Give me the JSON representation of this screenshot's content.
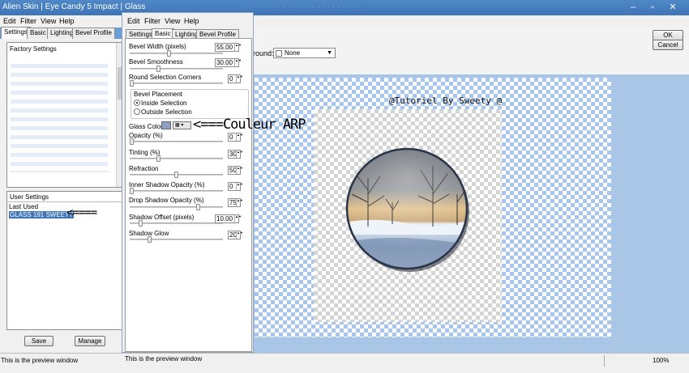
{
  "window": {
    "title": "Alien Skin | Eye Candy 5 Impact | Glass"
  },
  "menu": [
    "Edit",
    "Filter",
    "View",
    "Help"
  ],
  "back_tabs": [
    "Settings",
    "Basic",
    "Lighting",
    "Bevel Profile"
  ],
  "front_tabs": [
    "Settings",
    "Basic",
    "Lighting",
    "Bevel Profile"
  ],
  "settings_panel": {
    "factory_header": "Factory Settings",
    "user_header": "User Settings",
    "last_used": "Last Used",
    "selected_preset": "GLASS 191 SWEETY",
    "save_label": "Save",
    "manage_label": "Manage",
    "arrow_annotation": "<===="
  },
  "params": {
    "bevel_width": {
      "label": "Bevel Width (pixels)",
      "value": "55.00",
      "level": 0.42
    },
    "bevel_smoothness": {
      "label": "Bevel Smoothness",
      "value": "30.00",
      "level": 0.3
    },
    "round_corners": {
      "label": "Round Selection Corners",
      "value": "0",
      "level": 0.0
    },
    "bevel_placement": {
      "label": "Bevel Placement",
      "inside": "Inside Selection",
      "outside": "Outside Selection",
      "selected": "inside"
    },
    "glass_color": {
      "label": "Glass Color",
      "value": "#8ba1c4"
    },
    "color_annotation": "<===Couleur ARP",
    "opacity": {
      "label": "Opacity (%)",
      "value": "0",
      "level": 0.0
    },
    "tinting": {
      "label": "Tinting (%)",
      "value": "30",
      "level": 0.3
    },
    "refraction": {
      "label": "Refraction",
      "value": "50",
      "level": 0.5
    },
    "inner_shadow": {
      "label": "Inner Shadow Opacity (%)",
      "value": "0",
      "level": 0.0
    },
    "drop_shadow": {
      "label": "Drop Shadow Opacity (%)",
      "value": "75",
      "level": 0.75
    },
    "shadow_offset": {
      "label": "Shadow Offset (pixels)",
      "value": "10.00",
      "level": 0.1
    },
    "shadow_glow": {
      "label": "Shadow Glow",
      "value": "20",
      "level": 0.2
    }
  },
  "options": {
    "background_label": "round:",
    "background_value": "None",
    "ok_label": "OK",
    "cancel_label": "Cancel"
  },
  "preview": {
    "watermark": "@Tutoriel By Sweety @"
  },
  "status": {
    "back_text": "This is the preview window",
    "front_text": "This is the preview window",
    "zoom": "100%"
  }
}
